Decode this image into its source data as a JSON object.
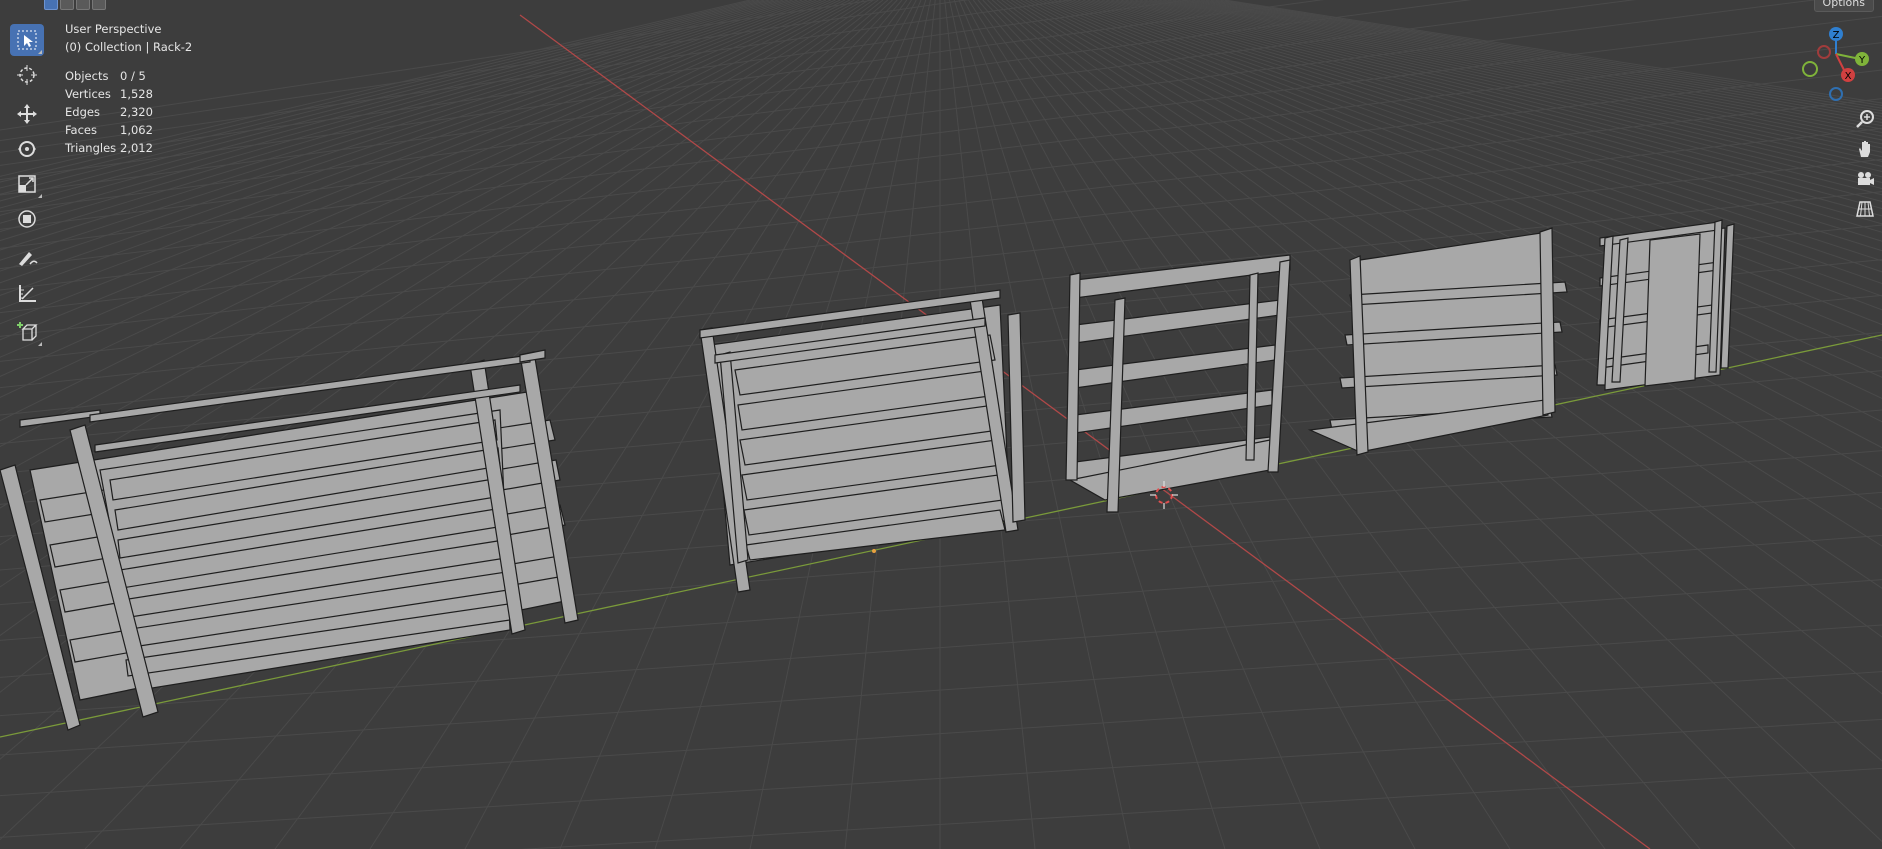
{
  "viewport": {
    "perspective_label": "User Perspective",
    "collection_label": "(0) Collection | Rack-2"
  },
  "stats": [
    {
      "label": "Objects",
      "value": "0 / 5"
    },
    {
      "label": "Vertices",
      "value": "1,528"
    },
    {
      "label": "Edges",
      "value": "2,320"
    },
    {
      "label": "Faces",
      "value": "1,062"
    },
    {
      "label": "Triangles",
      "value": "2,012"
    }
  ],
  "header": {
    "options_label": "Options"
  },
  "gizmo": {
    "x_label": "X",
    "y_label": "Y",
    "z_label": "Z"
  },
  "toolbar": {
    "tools": [
      "select-box-icon",
      "cursor-icon",
      "move-icon",
      "rotate-icon",
      "scale-icon",
      "transform-icon",
      "annotate-icon",
      "measure-icon",
      "add-cube-icon"
    ],
    "active_tool": "select-box-icon"
  },
  "navigation": {
    "icons": [
      "zoom-icon",
      "pan-hand-icon",
      "camera-icon",
      "grid-view-icon"
    ]
  },
  "colors": {
    "background": "#3d3d3d",
    "grid_line": "#4a4a4a",
    "x_axis": "#b04848",
    "y_axis": "#7a9a3a",
    "active_tool": "#4772b3",
    "mesh_fill": "#a8a8a8",
    "mesh_edge": "#1e1e1e"
  }
}
